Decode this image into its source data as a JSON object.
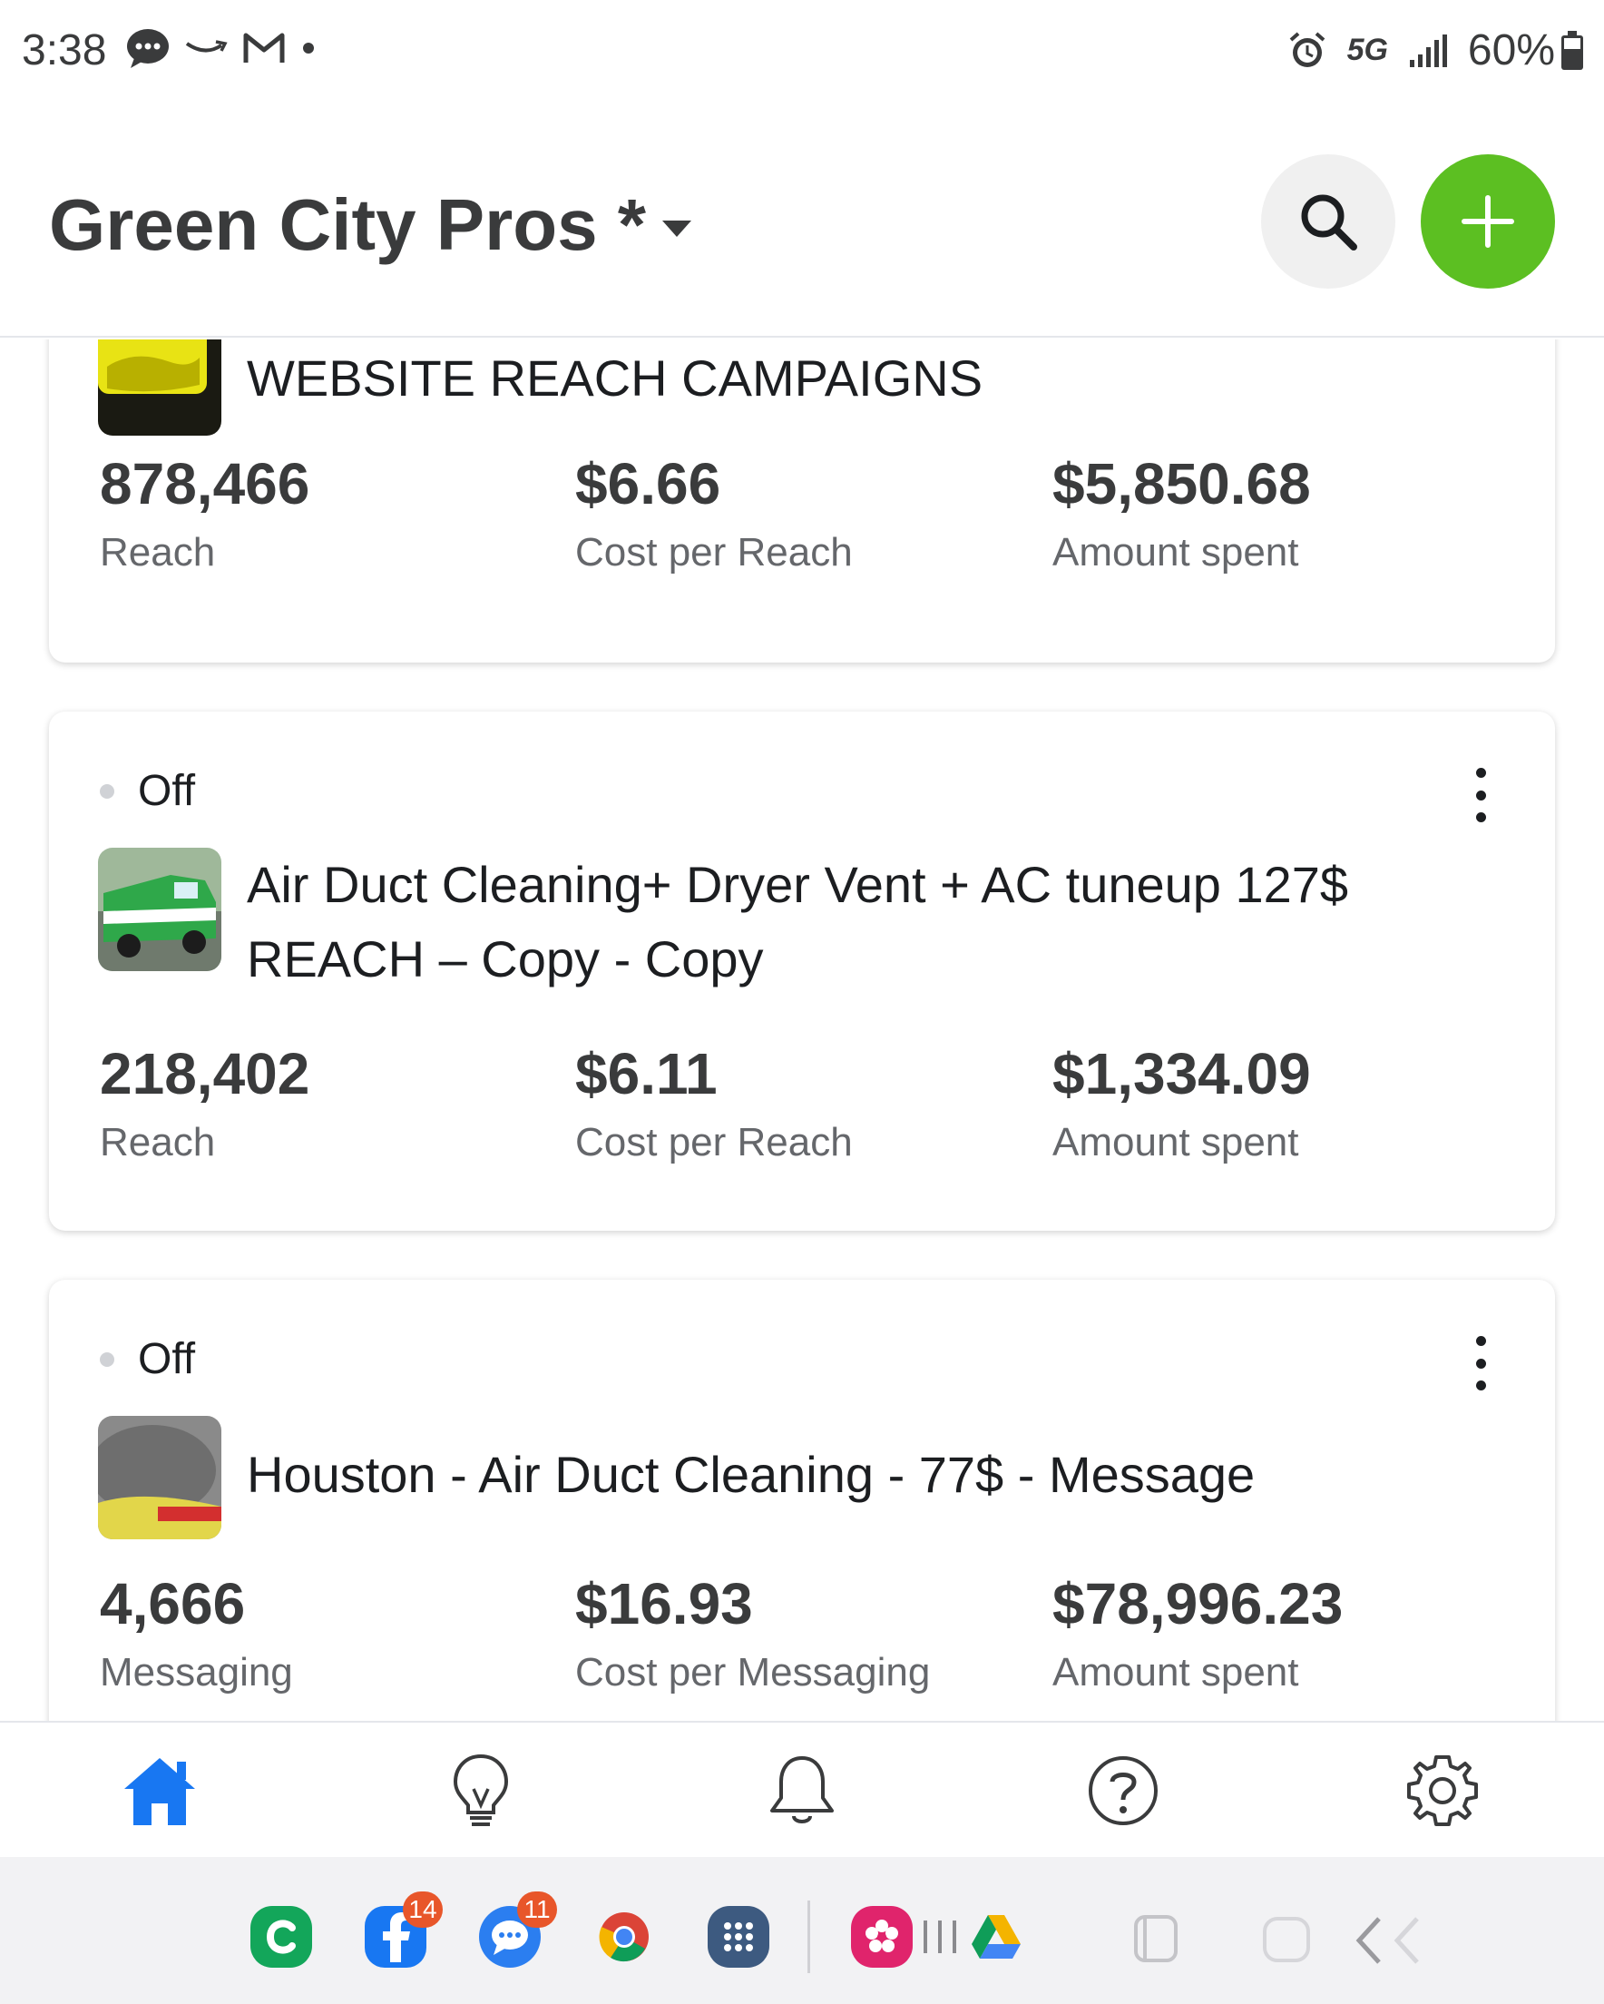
{
  "status_bar": {
    "time": "3:38",
    "network": "5G",
    "battery": "60%"
  },
  "header": {
    "account_name": "Green City Pros *"
  },
  "campaigns": [
    {
      "status": "",
      "title": "WEBSITE REACH CAMPAIGNS",
      "metrics": [
        {
          "value": "878,466",
          "label": "Reach"
        },
        {
          "value": "$6.66",
          "label": "Cost per Reach"
        },
        {
          "value": "$5,850.68",
          "label": "Amount spent"
        }
      ]
    },
    {
      "status": "Off",
      "title": "Air Duct Cleaning+ Dryer Vent + AC tuneup 127$ REACH – Copy - Copy",
      "metrics": [
        {
          "value": "218,402",
          "label": "Reach"
        },
        {
          "value": "$6.11",
          "label": "Cost per Reach"
        },
        {
          "value": "$1,334.09",
          "label": "Amount spent"
        }
      ]
    },
    {
      "status": "Off",
      "title": "Houston - Air Duct Cleaning - 77$ - Message",
      "metrics": [
        {
          "value": "4,666",
          "label": "Messaging"
        },
        {
          "value": "$16.93",
          "label": "Cost per Messaging"
        },
        {
          "value": "$78,996.23",
          "label": "Amount spent"
        }
      ]
    }
  ],
  "bottom_nav": {
    "items": [
      "home-icon",
      "lightbulb-icon",
      "bell-icon",
      "help-icon",
      "gear-icon"
    ],
    "active": "home-icon",
    "active_color": "#1877f2"
  },
  "dock": {
    "facebook_badge": "14",
    "messages_badge": "11"
  },
  "colors": {
    "accent_green": "#5cbf22",
    "text_primary": "#1c1e21",
    "text_secondary": "#65676b"
  }
}
